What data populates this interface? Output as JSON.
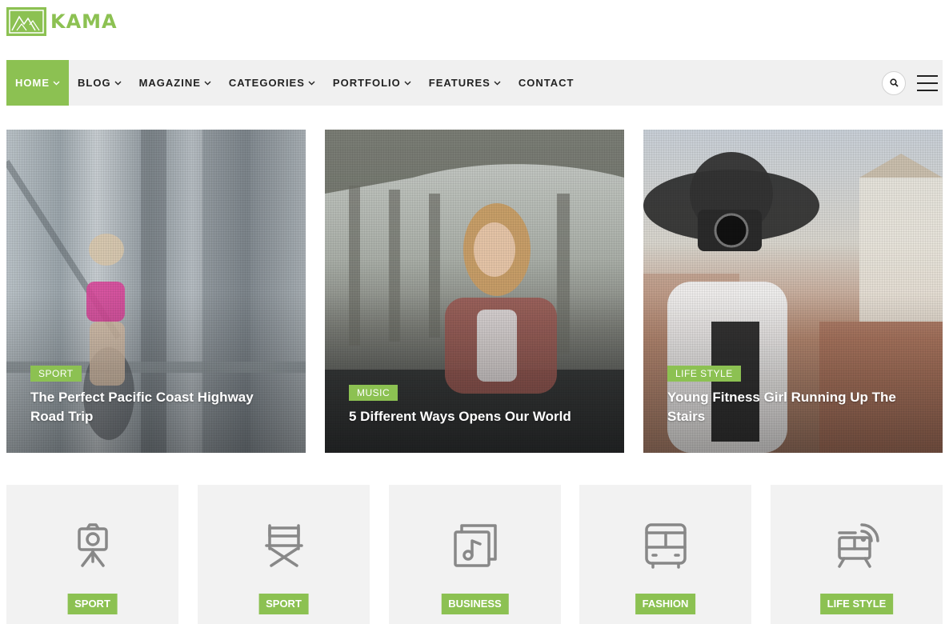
{
  "brand": {
    "name": "KAMA",
    "accent": "#8cc152"
  },
  "nav": {
    "items": [
      {
        "label": "HOME",
        "has_dropdown": true,
        "active": true
      },
      {
        "label": "BLOG",
        "has_dropdown": true
      },
      {
        "label": "MAGAZINE",
        "has_dropdown": true
      },
      {
        "label": "CATEGORIES",
        "has_dropdown": true
      },
      {
        "label": "PORTFOLIO",
        "has_dropdown": true
      },
      {
        "label": "FEATURES",
        "has_dropdown": true
      },
      {
        "label": "CONTACT",
        "has_dropdown": false
      }
    ],
    "tools": {
      "search_icon": "search-icon",
      "menu_icon": "hamburger-menu-icon"
    }
  },
  "featured": [
    {
      "tag": "SPORT",
      "title": "The Perfect Pacific Coast Highway Road Trip"
    },
    {
      "tag": "MUSIC",
      "title": "5 Different Ways Opens Our World"
    },
    {
      "tag": "LIFE STYLE",
      "title": "Young Fitness Girl Running Up The Stairs"
    }
  ],
  "categories": [
    {
      "label": "SPORT",
      "icon": "camera-tripod-icon"
    },
    {
      "label": "SPORT",
      "icon": "director-chair-icon"
    },
    {
      "label": "BUSINESS",
      "icon": "music-album-icon"
    },
    {
      "label": "FASHION",
      "icon": "bus-icon"
    },
    {
      "label": "LIFE STYLE",
      "icon": "wifi-train-icon"
    }
  ]
}
